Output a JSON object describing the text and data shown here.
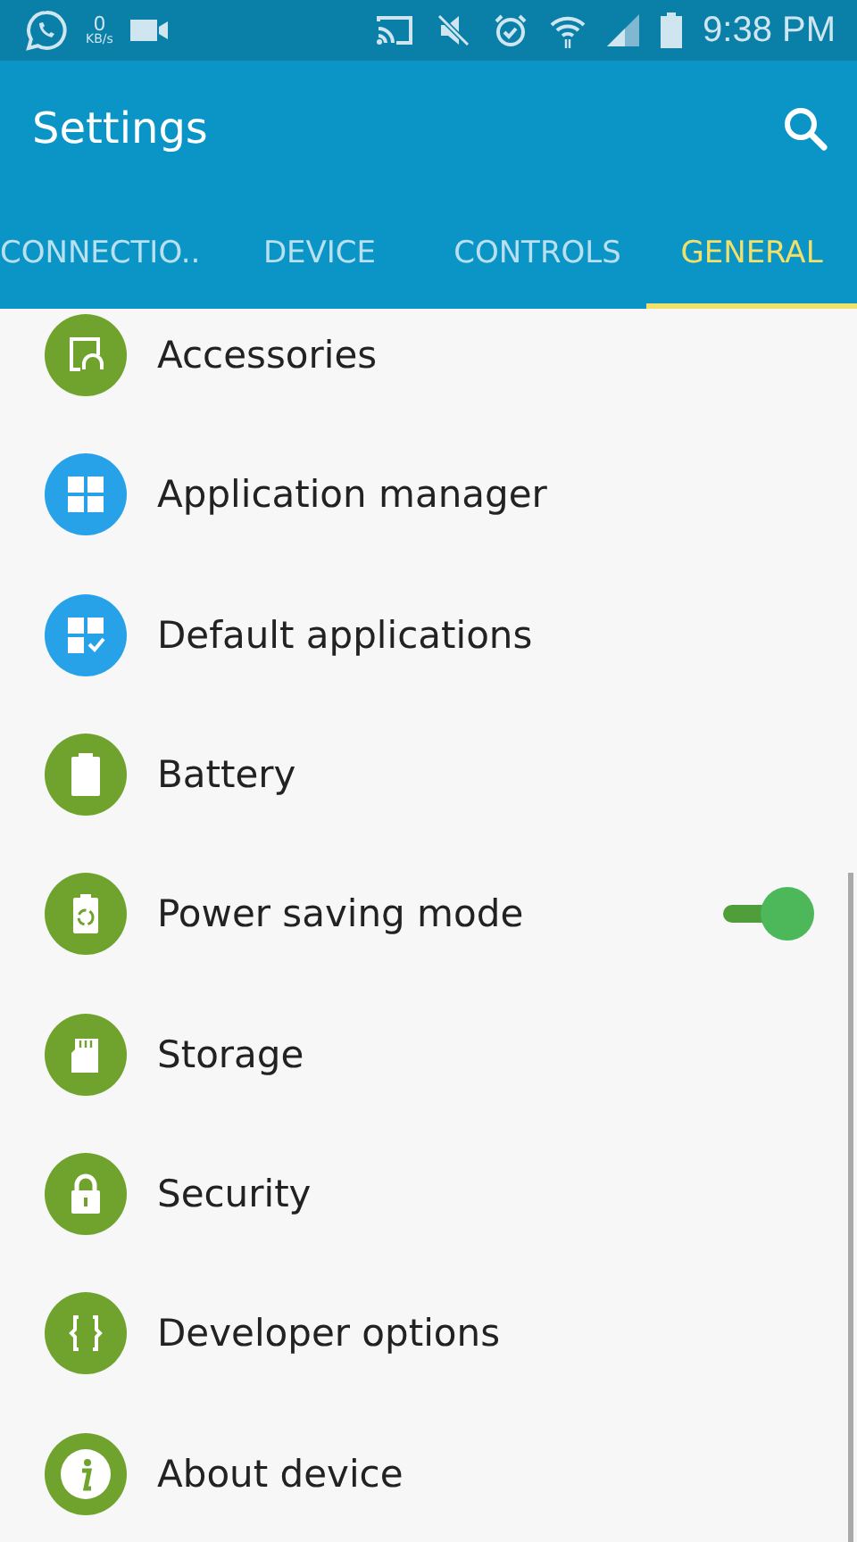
{
  "status_bar": {
    "speed_value": "0",
    "speed_unit": "KB/s",
    "time": "9:38 PM"
  },
  "app_bar": {
    "title": "Settings"
  },
  "tabs": [
    {
      "label": "CONNECTIO..",
      "selected": false
    },
    {
      "label": "DEVICE",
      "selected": false
    },
    {
      "label": "CONTROLS",
      "selected": false
    },
    {
      "label": "GENERAL",
      "selected": true
    }
  ],
  "items": [
    {
      "label": "Accessories",
      "color": "#6fa32e"
    },
    {
      "label": "Application manager",
      "color": "#27a2e8"
    },
    {
      "label": "Default applications",
      "color": "#27a2e8"
    },
    {
      "label": "Battery",
      "color": "#6fa32e"
    },
    {
      "label": "Power saving mode",
      "color": "#6fa32e",
      "kind": "toggle",
      "on": true
    },
    {
      "label": "Storage",
      "color": "#6fa32e"
    },
    {
      "label": "Security",
      "color": "#6fa32e"
    },
    {
      "label": "Developer options",
      "color": "#6fa32e"
    },
    {
      "label": "About device",
      "color": "#6fa32e"
    }
  ]
}
